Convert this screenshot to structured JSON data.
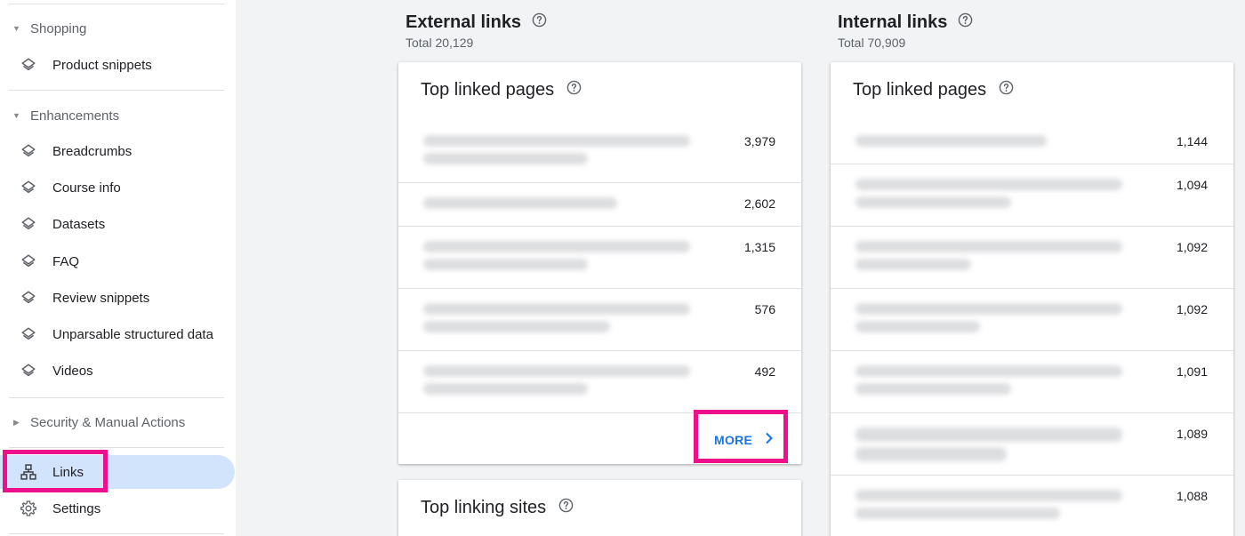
{
  "sidebar": {
    "sections": [
      {
        "label": "Shopping"
      },
      {
        "label": "Enhancements"
      },
      {
        "label": "Security & Manual Actions"
      }
    ],
    "items": [
      {
        "label": "Product snippets"
      },
      {
        "label": "Breadcrumbs"
      },
      {
        "label": "Course info"
      },
      {
        "label": "Datasets"
      },
      {
        "label": "FAQ"
      },
      {
        "label": "Review snippets"
      },
      {
        "label": "Unparsable structured data"
      },
      {
        "label": "Videos"
      },
      {
        "label": "Links"
      },
      {
        "label": "Settings"
      }
    ],
    "active_item": "Links"
  },
  "external": {
    "title": "External links",
    "total": "Total 20,129",
    "top_pages": {
      "title": "Top linked pages",
      "values": [
        "3,979",
        "2,602",
        "1,315",
        "576",
        "492"
      ],
      "more_label": "MORE"
    },
    "top_sites": {
      "title": "Top linking sites"
    }
  },
  "internal": {
    "title": "Internal links",
    "total": "Total 70,909",
    "top_pages": {
      "title": "Top linked pages",
      "values": [
        "1,144",
        "1,094",
        "1,092",
        "1,092",
        "1,091",
        "1,089",
        "1,088"
      ]
    }
  },
  "colors": {
    "accent": "#1a73e8",
    "active_bg": "#d2e3fc",
    "highlight": "#ed0f8c"
  }
}
